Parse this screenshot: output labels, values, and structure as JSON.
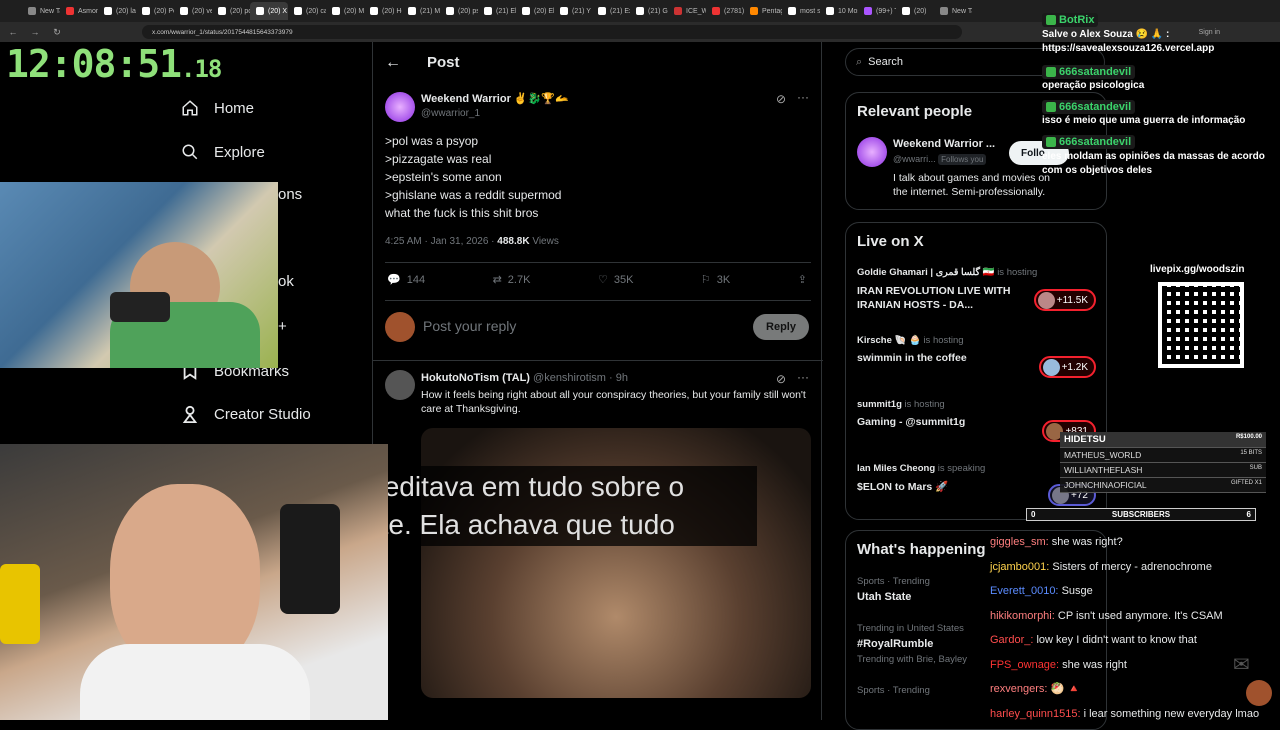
{
  "tabs": [
    {
      "label": "New Tab",
      "color": "#888"
    },
    {
      "label": "Asmongold",
      "color": "#e33"
    },
    {
      "label": "(20) la",
      "color": "#fff"
    },
    {
      "label": "(20) Po",
      "color": "#fff"
    },
    {
      "label": "(20) ve",
      "color": "#fff"
    },
    {
      "label": "(20) po",
      "color": "#fff"
    },
    {
      "label": "(20) X",
      "color": "#fff",
      "active": true
    },
    {
      "label": "(20) cal",
      "color": "#fff"
    },
    {
      "label": "(20) Me",
      "color": "#fff"
    },
    {
      "label": "(20) Ho",
      "color": "#fff"
    },
    {
      "label": "(21) Mo",
      "color": "#fff"
    },
    {
      "label": "(20) psy",
      "color": "#fff"
    },
    {
      "label": "(21) Ele",
      "color": "#fff"
    },
    {
      "label": "(20) Ele",
      "color": "#fff"
    },
    {
      "label": "(21) Y",
      "color": "#fff"
    },
    {
      "label": "(21) Exp",
      "color": "#fff"
    },
    {
      "label": "(21) Gro",
      "color": "#fff"
    },
    {
      "label": "ICE_We",
      "color": "#c33"
    },
    {
      "label": "(2781)",
      "color": "#e33"
    },
    {
      "label": "Pentago",
      "color": "#f80"
    },
    {
      "label": "most su",
      "color": "#fff"
    },
    {
      "label": "10 Mos",
      "color": "#fff"
    },
    {
      "label": "(99+) T",
      "color": "#a5f"
    },
    {
      "label": "(20)",
      "color": "#fff"
    },
    {
      "label": "New Ta",
      "color": "#888"
    }
  ],
  "browser": {
    "url": "x.com/wwarrior_1/status/2017544815643373979",
    "signin": "Sign in"
  },
  "clock": {
    "main": "12:08:51",
    "fraction": ".18"
  },
  "nav": {
    "home": "Home",
    "explore": "Explore",
    "notifications_partial": "ons",
    "partial_ok": "ok",
    "partial_plus": "+",
    "bookmarks": "Bookmarks",
    "creator_studio": "Creator Studio"
  },
  "post": {
    "header": "Post",
    "author_name": "Weekend Warrior",
    "author_emojis": "✌️🐉🏆🫴",
    "handle": "@wwarrior_1",
    "lines": [
      ">pol was a psyop",
      ">pizzagate was real",
      ">epstein's some anon",
      ">ghislane was a reddit supermod",
      "what the fuck is this shit bros"
    ],
    "time": "4:25 AM · Jan 31, 2026 · ",
    "views_count": "488.8K",
    "views_label": "Views",
    "replies": "144",
    "reposts": "2.7K",
    "likes": "35K",
    "bookmarks": "3K",
    "reply_placeholder": "Post your reply",
    "reply_button": "Reply"
  },
  "reply": {
    "author_name": "HokutoNoTism (TAL)",
    "handle": "@kenshirotism · 9h",
    "text": "How it feels being right about all your conspiracy theories, but your family still won't care at Thanksgiving."
  },
  "subtitles": {
    "line1": ".  Ela acreditava em tudo sobre o",
    "line2": "Pizzagate.  Ela achava que tudo"
  },
  "right": {
    "search_placeholder": "Search",
    "relevant_title": "Relevant people",
    "rp_name": "Weekend Warrior ...",
    "rp_handle": "@wwarri...",
    "rp_follows": "Follows you",
    "rp_follow_btn": "Follo",
    "rp_bio": "I talk about games and movies on the internet. Semi-professionally.",
    "live_title": "Live on X",
    "live": [
      {
        "host": "Goldie Ghamari | گلسا قمری 🇮🇷",
        "status": "is hosting",
        "title": "IRAN REVOLUTION LIVE WITH IRANIAN HOSTS - DA...",
        "count": "+11.5K"
      },
      {
        "host": "Kirsche 🐚 🧁",
        "status": "is hosting",
        "title": "swimmin in the coffee",
        "count": "+1.2K"
      },
      {
        "host": "summit1g",
        "status": "is hosting",
        "title": "Gaming - @summit1g",
        "count": "+831"
      },
      {
        "host": "Ian Miles Cheong",
        "status": "is speaking",
        "title": "$ELON to Mars 🚀",
        "count": "+72"
      }
    ],
    "happening_title": "What's happening",
    "trends": [
      {
        "meta": "Sports · Trending",
        "name": "Utah State",
        "extra": ""
      },
      {
        "meta": "Trending in United States",
        "name": "#RoyalRumble",
        "extra": "Trending with Brie, Bayley"
      },
      {
        "meta": "Sports · Trending",
        "name": "",
        "extra": ""
      }
    ]
  },
  "overlay_chat_top": [
    {
      "user": "BotRix",
      "msg": "Salve o Alex Souza 😢 🙏 : https://savealexsouza126.vercel.app"
    },
    {
      "user": "666satandevil",
      "msg": "operação psicologica"
    },
    {
      "user": "666satandevil",
      "msg": "isso é meio que uma guerra de informação"
    },
    {
      "user": "666satandevil",
      "msg": "eles moldam as opiniões da massas de acordo com os objetivos deles"
    }
  ],
  "livepix": "livepix.gg/woodszin",
  "subsbox": {
    "rows": [
      {
        "name": "HIDETSU",
        "val": "R$100.00"
      },
      {
        "name": "MATHEUS_WORLD",
        "val": "15 BITS"
      },
      {
        "name": "WILLIANTHEFLASH",
        "val": "SUB"
      },
      {
        "name": "JOHNCHINAOFICIAL",
        "val": "GIFTED X1"
      }
    ],
    "left": "0",
    "label": "SUBSCRIBERS",
    "right": "6"
  },
  "chat": [
    {
      "user": "giggles_sm:",
      "color": "#ff7f7f",
      "msg": "she was right?"
    },
    {
      "user": "jcjambo001:",
      "color": "#ffd34d",
      "msg": "Sisters of mercy - adrenochrome"
    },
    {
      "user": "Everett_0010:",
      "color": "#5b8cff",
      "msg": "Susge"
    },
    {
      "user": "hikikomorphi:",
      "color": "#ff7f7f",
      "msg": "CP isn't used anymore. It's CSAM"
    },
    {
      "user": "Gardor_:",
      "color": "#ff4d4d",
      "msg": "low key I didn't want to know that"
    },
    {
      "user": "FPS_ownage:",
      "color": "#ff3333",
      "msg": "she was right"
    },
    {
      "user": "rexvengers:",
      "color": "#ff7f7f",
      "msg": "🥙 🔺"
    },
    {
      "user": "harley_quinn1515:",
      "color": "#ff4d4d",
      "msg": "i lear something new everyday lmao"
    }
  ]
}
